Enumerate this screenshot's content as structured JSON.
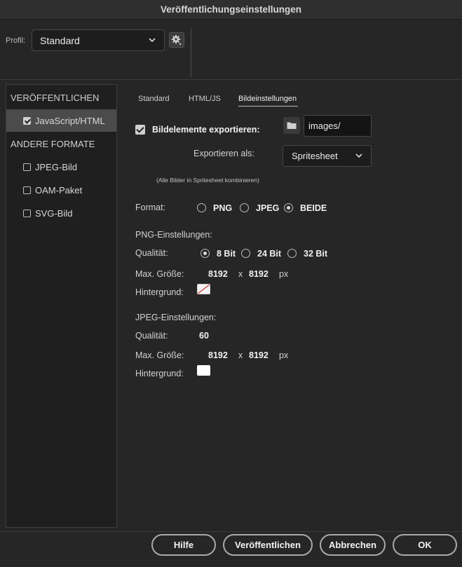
{
  "window": {
    "title": "Veröffentlichungseinstellungen"
  },
  "profile": {
    "label": "Profil:",
    "value": "Standard",
    "icons": [
      "chevron-down-icon",
      "gear-icon"
    ]
  },
  "sidebar": {
    "section1": "VERÖFFENTLICHEN",
    "section2": "ANDERE FORMATE",
    "items": [
      {
        "label": "JavaScript/HTML",
        "checked": true,
        "selected": true
      },
      {
        "label": "JPEG-Bild",
        "checked": false
      },
      {
        "label": "OAM-Paket",
        "checked": false
      },
      {
        "label": "SVG-Bild",
        "checked": false
      }
    ]
  },
  "tabs": [
    {
      "label": "Standard",
      "active": false
    },
    {
      "label": "HTML/JS",
      "active": false
    },
    {
      "label": "Bildeinstellungen",
      "active": true
    }
  ],
  "export": {
    "checkbox_label": "Bildelemente exportieren:",
    "checked": true,
    "folder_value": "images/",
    "export_as_label": "Exportieren als:",
    "export_as_value": "Spritesheet",
    "hint": "(Alle Bilder in Spritesheet kombinieren)"
  },
  "format": {
    "label": "Format:",
    "options": [
      "PNG",
      "JPEG",
      "BEIDE"
    ],
    "selected": "BEIDE"
  },
  "png": {
    "heading": "PNG-Einstellungen:",
    "quality_label": "Qualität:",
    "quality_options": [
      "8 Bit",
      "24 Bit",
      "32 Bit"
    ],
    "quality_selected": "8 Bit",
    "maxsize_label": "Max. Größe:",
    "width": "8192",
    "x": "x",
    "height": "8192",
    "unit": "px",
    "background_label": "Hintergrund:",
    "background": "none"
  },
  "jpeg": {
    "heading": "JPEG-Einstellungen:",
    "quality_label": "Qualität:",
    "quality_value": "60",
    "maxsize_label": "Max. Größe:",
    "width": "8192",
    "x": "x",
    "height": "8192",
    "unit": "px",
    "background_label": "Hintergrund:",
    "background": "#ffffff"
  },
  "buttons": {
    "help": "Hilfe",
    "publish": "Veröffentlichen",
    "cancel": "Abbrechen",
    "ok": "OK"
  }
}
